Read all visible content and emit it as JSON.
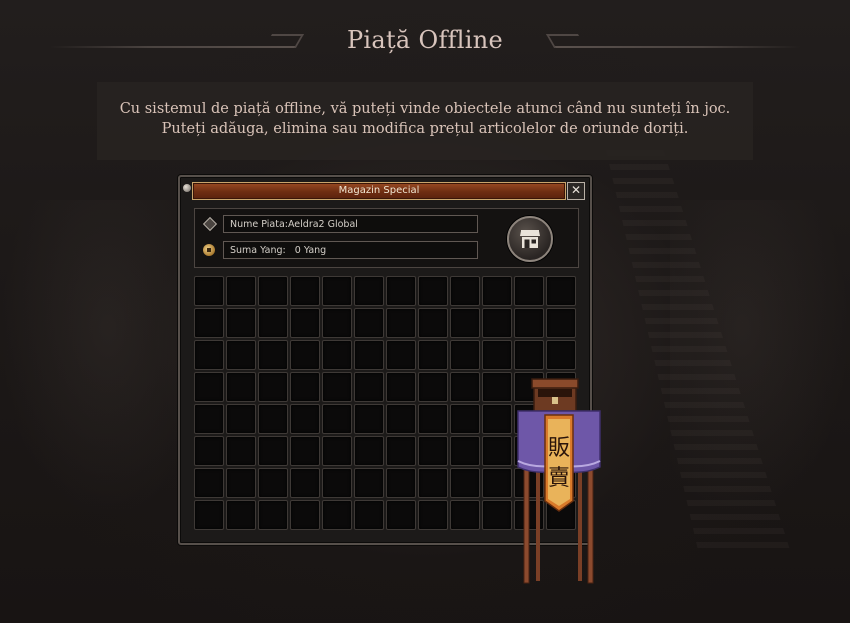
{
  "page": {
    "title": "Piață Offline",
    "description": "Cu sistemul de piață offline, vă puteți vinde obiectele atunci când nu sunteți în joc. Puteți adăuga, elimina sau modifica prețul articolelor de oriunde doriți."
  },
  "window": {
    "title": "Magazin Special",
    "close_glyph": "✕",
    "market_name_row": "Nume Piata:Aeldra2 Global",
    "yang_row": "Suma Yang:   0 Yang",
    "icons": {
      "market_name": "diamond-icon",
      "yang": "coin-icon",
      "shop": "shop-icon"
    },
    "grid": {
      "columns": 12,
      "rows": 8
    }
  },
  "colors": {
    "title_text": "#d8c4bc",
    "titlebar": "#7a3416",
    "stall_cloth": "#6e57a8",
    "banner": "#d97a2a"
  }
}
